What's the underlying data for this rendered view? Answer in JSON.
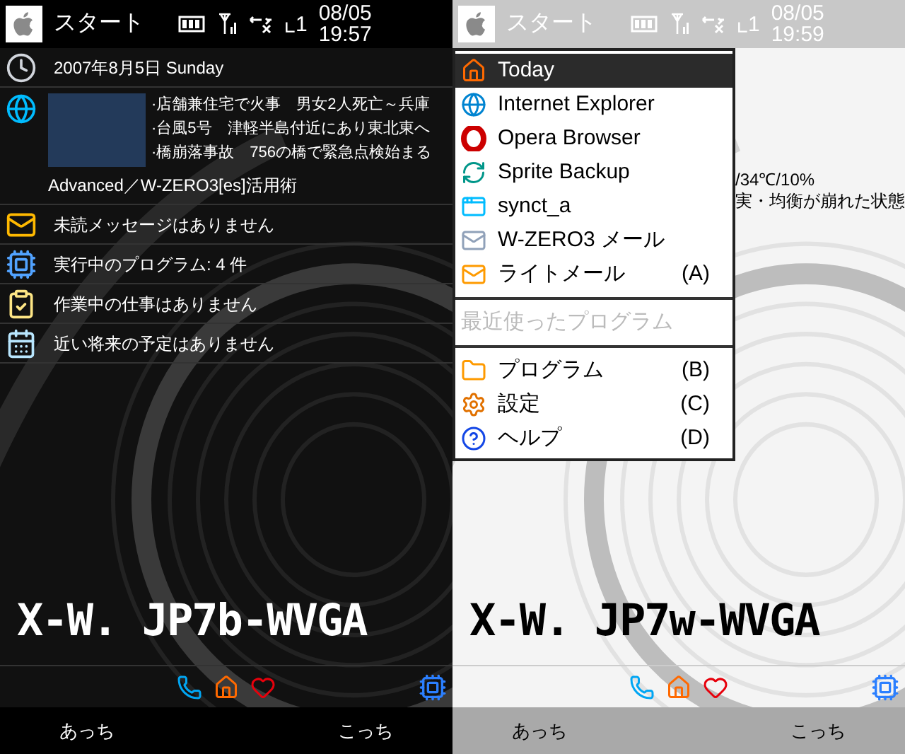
{
  "screens": [
    {
      "kind": "dark",
      "status_bar": {
        "start_label": "スタート",
        "date": "08/05",
        "time": "19:57",
        "ringer": "1"
      },
      "today_items": [
        {
          "kind": "date",
          "text": "2007年8月5日 Sunday"
        },
        {
          "kind": "news",
          "headlines": [
            "·店舗兼住宅で火事　男女2人死亡～兵庫",
            "·台風5号　津軽半島付近にあり東北東へ",
            "·橋崩落事故　756の橋で緊急点検始まる"
          ],
          "source": "Advanced／W-ZERO3[es]活用術"
        },
        {
          "kind": "messages",
          "text": "未読メッセージはありません"
        },
        {
          "kind": "programs",
          "text": "実行中のプログラム: 4 件"
        },
        {
          "kind": "tasks",
          "text": "作業中の仕事はありません"
        },
        {
          "kind": "calendar",
          "text": "近い将来の予定はありません"
        }
      ],
      "theme_name": "X-W. JP7b-WVGA",
      "softkeys": [
        "あっち",
        "こっち"
      ]
    },
    {
      "kind": "light",
      "status_bar": {
        "start_label": "スタート",
        "date": "08/05",
        "time": "19:59",
        "ringer": "1"
      },
      "background_text": [
        "/34℃/10%",
        "実・均衡が崩れた状態"
      ],
      "start_menu": {
        "apps": [
          {
            "label": "Today",
            "selected": true
          },
          {
            "label": "Internet Explorer",
            "selected": false
          },
          {
            "label": "Opera Browser",
            "selected": false
          },
          {
            "label": "Sprite Backup",
            "selected": false
          },
          {
            "label": "synct_a",
            "selected": false
          },
          {
            "label": "W-ZERO3 メール",
            "selected": false
          },
          {
            "label": "ライトメール",
            "shortcut": "(A)",
            "selected": false
          }
        ],
        "recent_header": {
          "label": "最近使ったプログラム",
          "disabled": true
        },
        "system": [
          {
            "label": "プログラム",
            "shortcut": "(B)",
            "selected": false
          },
          {
            "label": "設定",
            "shortcut": "(C)",
            "selected": false
          },
          {
            "label": "ヘルプ",
            "shortcut": "(D)",
            "selected": false
          }
        ]
      },
      "theme_name": "X-W. JP7w-WVGA",
      "softkeys": [
        "あっち",
        "こっち"
      ]
    }
  ]
}
